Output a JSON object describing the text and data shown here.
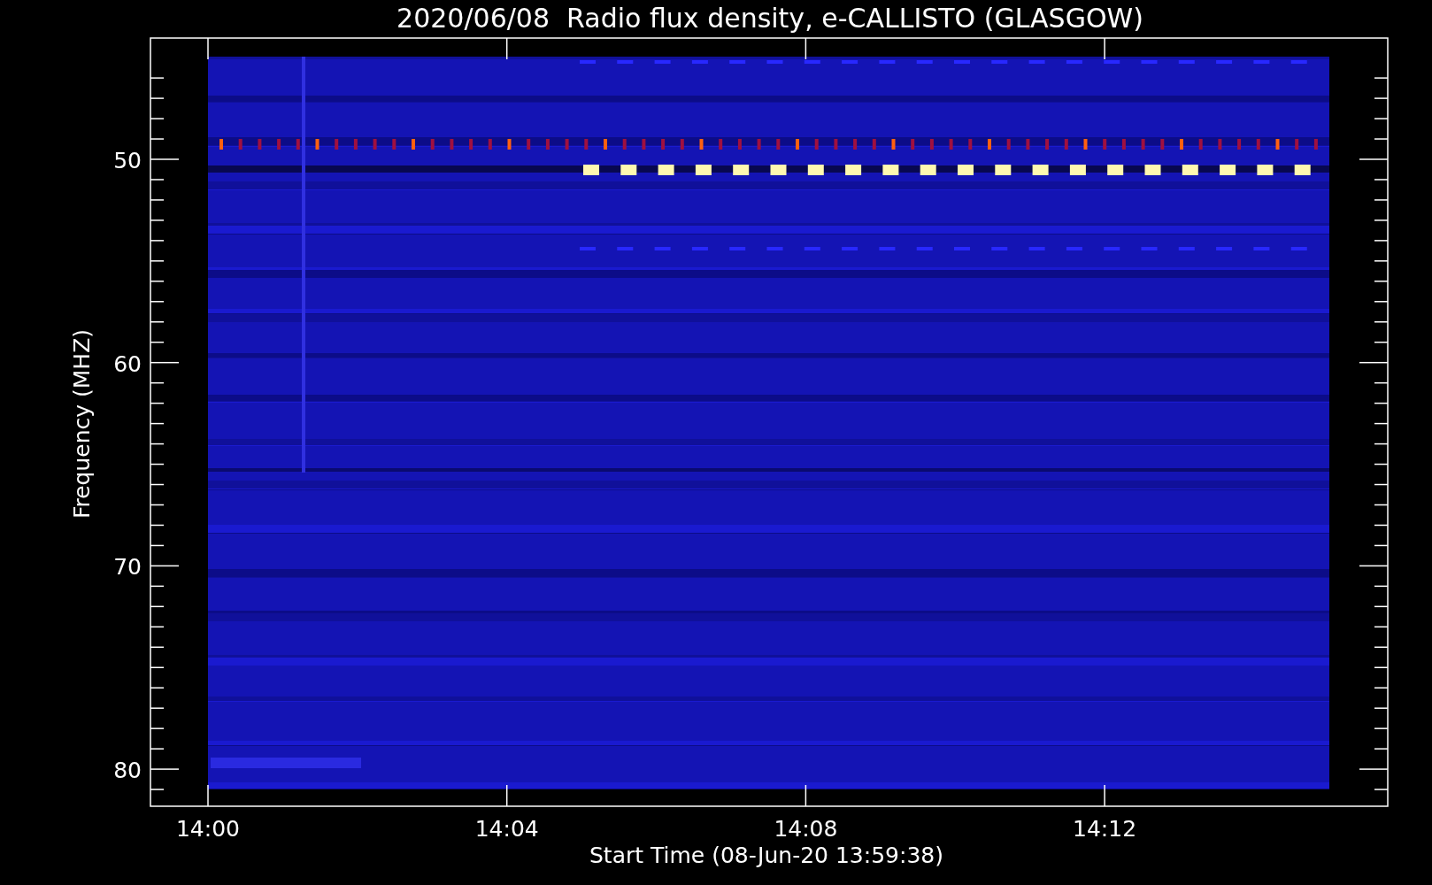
{
  "title": "2020/06/08  Radio flux density, e-CALLISTO (GLASGOW)",
  "plot": {
    "xlabel": "Start Time (08-Jun-20 13:59:38)",
    "ylabel": "Frequency (MHZ)",
    "xticks": [
      "14:00",
      "14:04",
      "14:08",
      "14:12"
    ],
    "yticks": [
      "50",
      "60",
      "70",
      "80"
    ]
  }
}
